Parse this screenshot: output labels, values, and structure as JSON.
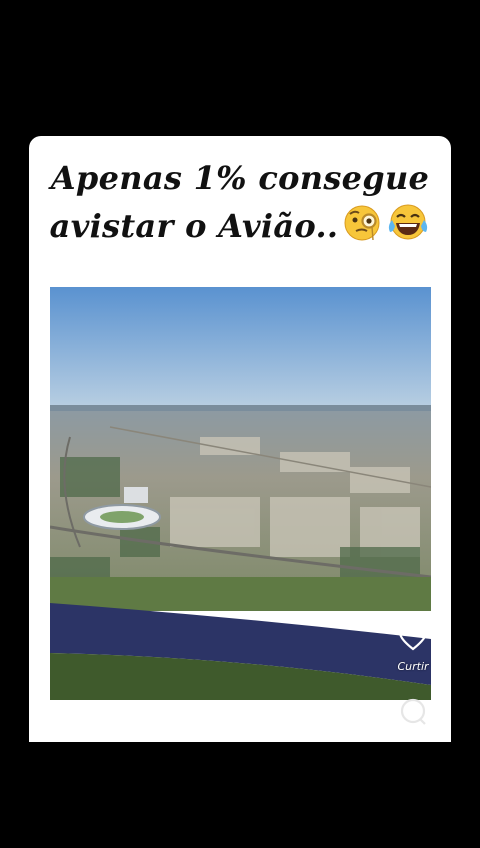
{
  "post": {
    "title_line1": "Apenas 1% consegue",
    "title_line2": "avistar o Avião..",
    "title_emojis": [
      "face-with-monocle-emoji",
      "laughing-tears-emoji"
    ]
  },
  "actions": {
    "like_label": "Curtir",
    "like_icon": "heart-icon",
    "comment_icon": "comment-icon"
  },
  "colors": {
    "background": "#000000",
    "card": "#ffffff",
    "sky": "#5f95d0",
    "river": "#2c3466"
  }
}
